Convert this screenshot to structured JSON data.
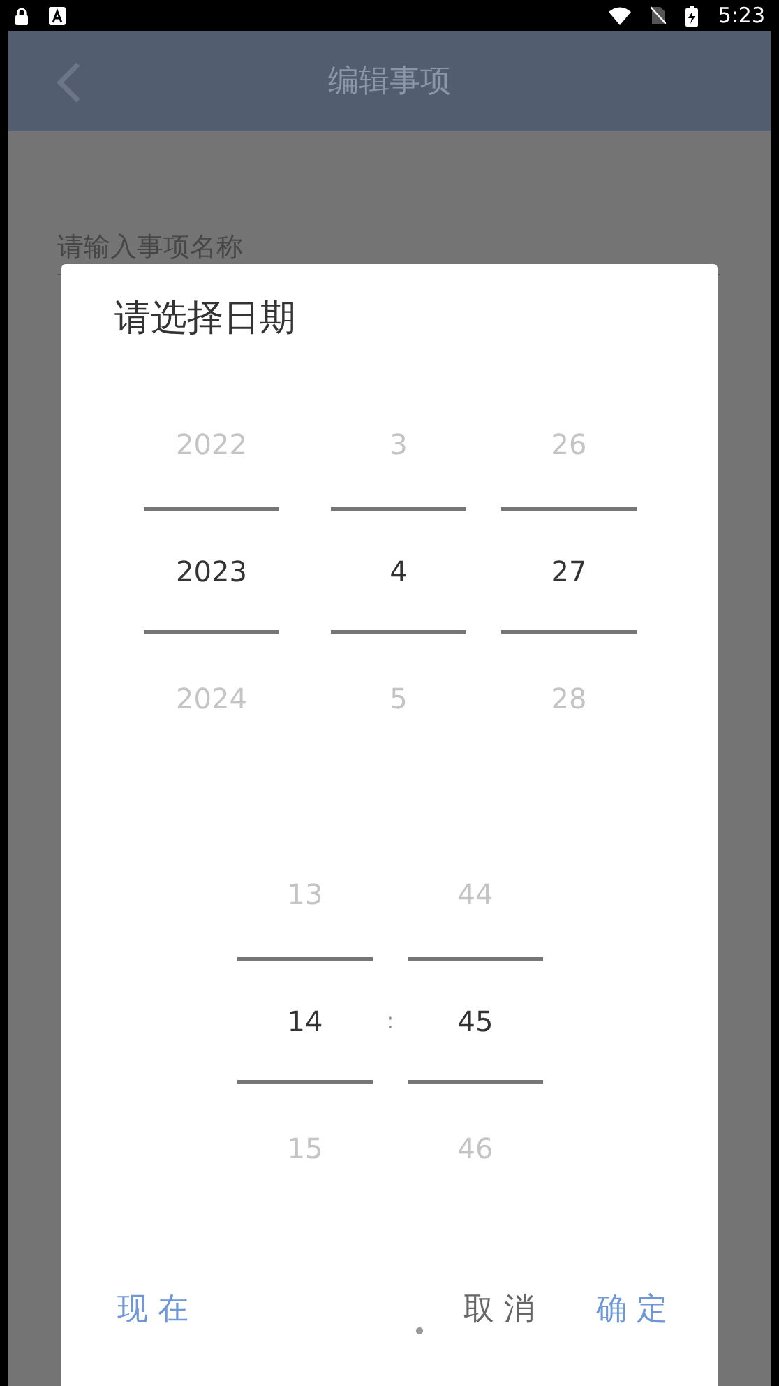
{
  "status_bar": {
    "time": "5:23"
  },
  "app_bar": {
    "title": "编辑事项"
  },
  "form": {
    "name_field": {
      "placeholder": "请输入事项名称"
    }
  },
  "dialog": {
    "title": "请选择日期",
    "date_columns": [
      {
        "items": [
          {
            "text": "2022",
            "selected": false
          },
          {
            "text": "2023",
            "selected": true
          },
          {
            "text": "2024",
            "selected": false
          }
        ]
      },
      {
        "items": [
          {
            "text": "3",
            "selected": false
          },
          {
            "text": "4",
            "selected": true
          },
          {
            "text": "5",
            "selected": false
          }
        ]
      },
      {
        "items": [
          {
            "text": "26",
            "selected": false
          },
          {
            "text": "27",
            "selected": true
          },
          {
            "text": "28",
            "selected": false
          }
        ]
      }
    ],
    "time_columns": [
      {
        "items": [
          {
            "text": "13",
            "selected": false
          },
          {
            "text": "14",
            "selected": true
          },
          {
            "text": "15",
            "selected": false
          }
        ]
      },
      {
        "items": [
          {
            "text": "44",
            "selected": false
          },
          {
            "text": "45",
            "selected": true
          },
          {
            "text": "46",
            "selected": false
          }
        ]
      }
    ],
    "time_separator": ":",
    "buttons": [
      {
        "label": "现 在",
        "kind": "accent"
      },
      {
        "label": "取 消",
        "kind": "neutral"
      },
      {
        "label": "确 定",
        "kind": "accent"
      }
    ]
  }
}
